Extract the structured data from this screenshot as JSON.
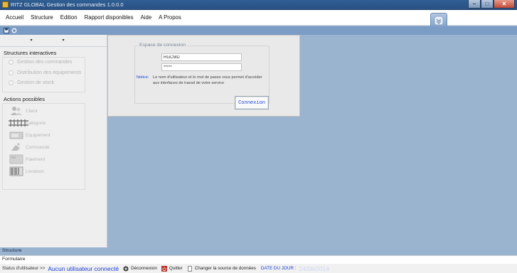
{
  "window": {
    "title": "RITZ GLOBAL  Gestion des commandes  1.0.0.0",
    "controls": {
      "minimize": "–",
      "maximize": "□",
      "close": "✕"
    }
  },
  "menu": {
    "items": [
      {
        "label": "Accueil"
      },
      {
        "label": "Structure"
      },
      {
        "label": "Edition"
      },
      {
        "label": "Rapport disponibles"
      },
      {
        "label": "Aide"
      },
      {
        "label": "A Propos"
      }
    ]
  },
  "sidebar": {
    "dropdown1": "▾",
    "dropdown2": "▾",
    "structures_title": "Structures interactives",
    "structures": [
      {
        "label": "Gestion des commandes"
      },
      {
        "label": "Distribution des équipements"
      },
      {
        "label": "Gestion de stock"
      }
    ],
    "actions_title": "Actions possibles",
    "actions": [
      {
        "label": "Client",
        "icon": "client-icon"
      },
      {
        "label": "Catégorie",
        "icon": "category-icon"
      },
      {
        "label": "Equipement",
        "icon": "equipment-icon"
      },
      {
        "label": "Commande",
        "icon": "order-icon"
      },
      {
        "label": "Paiement",
        "icon": "payment-icon"
      },
      {
        "label": "Livraison",
        "icon": "delivery-icon"
      }
    ],
    "structure_label": "Structure"
  },
  "footer_form": {
    "label": "Formulaire"
  },
  "login": {
    "legend": "Espace de connexion",
    "username_value": "RGCMD",
    "password_value": "*****",
    "notice_label": "Notice:",
    "notice_text": "Le nom d'utilisateur et le mot de passe vous permet d'accéder aux interfaces de travail de votre service",
    "button_label": "Connexion"
  },
  "statusbar": {
    "user_label": "Status d'utilisateur >>",
    "user_value": "Aucun utilisateur connecté",
    "logout_label": "Déconnexion",
    "quit_label": "Quitter",
    "source_label": "Changer la source de données",
    "date_label": "DATE DU JOUR  :",
    "date_value": "24/08/2014"
  },
  "colors": {
    "workspace": "#9ab3cf",
    "titlebar": "#2b568a",
    "accent_blue": "#1a3fd6"
  }
}
